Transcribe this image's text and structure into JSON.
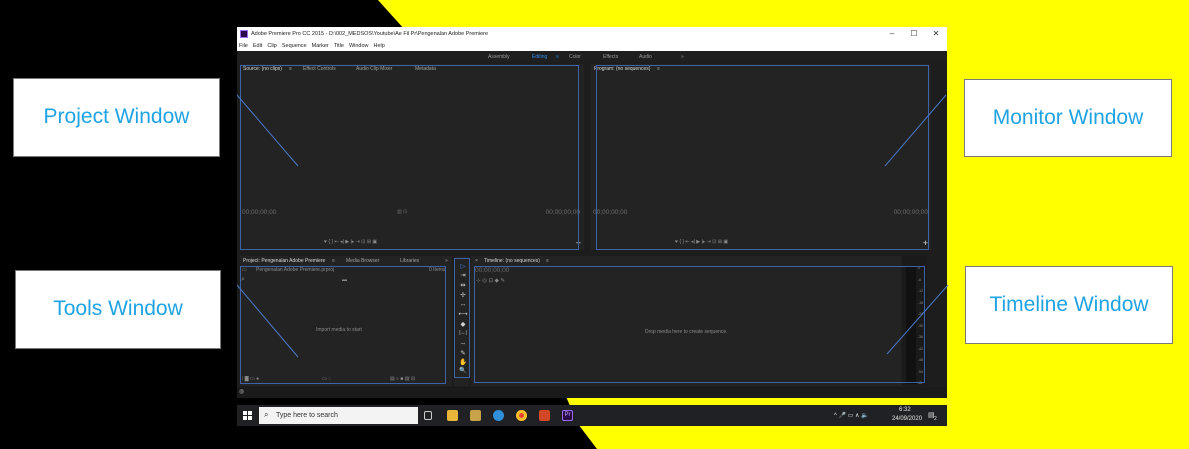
{
  "callouts": {
    "project": "Project Window",
    "monitor": "Monitor Window",
    "tools": "Tools Window",
    "timeline": "Timeline Window"
  },
  "app": {
    "title": "Adobe Premiere Pro CC 2015 - D:\\002_MEDSOS\\Youtube\\Ae Fil Pr\\Pengenalan Adobe Premiere",
    "window_controls": [
      "–",
      "☐",
      "✕"
    ],
    "menu": [
      "File",
      "Edit",
      "Clip",
      "Sequence",
      "Marker",
      "Title",
      "Window",
      "Help"
    ],
    "workspaces": [
      "Assembly",
      "Editing",
      "≡",
      "Color",
      "Effects",
      "Audio",
      "»"
    ]
  },
  "source_panel": {
    "tabs": [
      "Source: (no clips)",
      "≡",
      "Effect Controls",
      "Audio Clip Mixer",
      "Metadata"
    ],
    "timecode_left": "00;00;00;00",
    "timecode_right": "00;00;00;00",
    "controls": "♥   {   }    ⇤   ◂|   ▶   |▸   ⇥    ⊡   ⊞    ▣",
    "add": "+"
  },
  "program_panel": {
    "tabs": [
      "Program: (no sequences)",
      "≡"
    ],
    "timecode_left": "00;00;00;00",
    "timecode_right": "00;00;00;00",
    "controls": "♥   {   }    ⇤   ◂|   ▶   |▸   ⇥    ⊡   ⊞    ▣",
    "add": "+"
  },
  "project_panel": {
    "tabs": [
      "Project: Pengenalan Adobe Premiere",
      "≡",
      "Media Browser",
      "Libraries",
      "»"
    ],
    "file": "Pengenalan Adobe Premiere.prproj",
    "items": "0 Items",
    "search_icon": "⌕",
    "folder_icon": "▬",
    "message": "Import media to start",
    "bottom_left": "⁞ ▇ ▭ ●",
    "bottom_mid": "▭ ◌",
    "bottom_right": "▤ ⌕ ■ ▤ ⊟"
  },
  "tools": [
    "▷",
    "⇥",
    "⇹",
    "✢",
    "↔",
    "⟷",
    "◆",
    "|↔|",
    "⇔",
    "✎",
    "✋",
    "🔍"
  ],
  "timeline_panel": {
    "tabs": [
      "×",
      "Timeline: (no sequences)",
      "≡"
    ],
    "timecode": "00;00;00;00",
    "tools_row": "⊹    ◎    ⊡    ◆    ✎",
    "message": "Drop media here to create sequence."
  },
  "audio_meter": {
    "ticks": [
      "0",
      "-6",
      "-12",
      "-18",
      "-24",
      "-30",
      "-36",
      "-42",
      "-48",
      "-54",
      "dB"
    ]
  },
  "taskbar": {
    "search_placeholder": "Type here to search",
    "time": "6:32",
    "date": "24/09/2020",
    "notification_count": "2",
    "tray_icons": "^  🎤  ▭  ∧  🔈"
  },
  "colors": {
    "yellow": "#ffff00",
    "callout_text": "#1fa3e3",
    "highlight": "#3d63a8",
    "active_tab": "#2d8ceb",
    "panel_bg": "#232323"
  }
}
